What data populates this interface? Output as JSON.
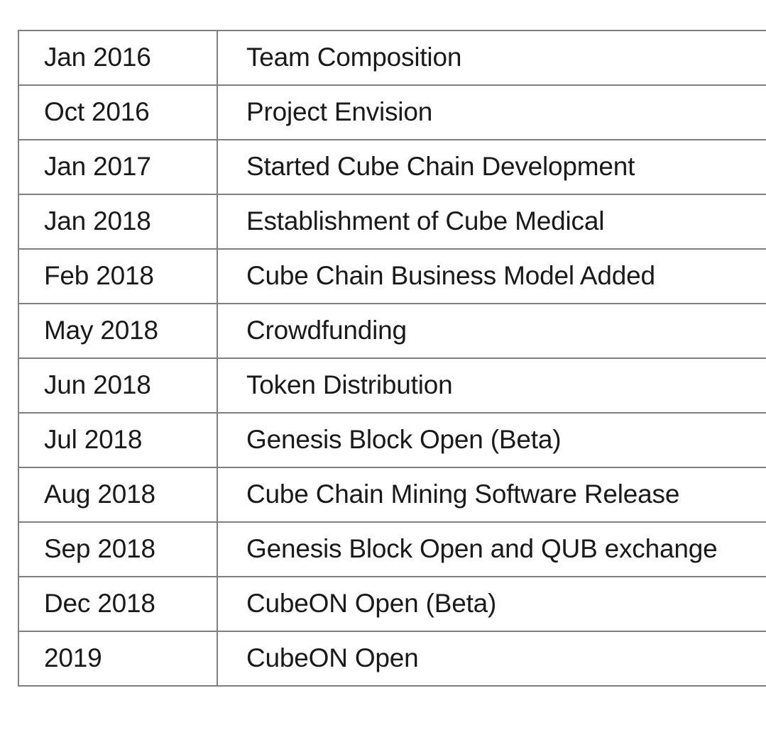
{
  "table": {
    "columns": [
      "date",
      "event"
    ],
    "border_color": "#7f7f7f",
    "text_color": "#1a1a1a",
    "background_color": "#ffffff",
    "rows": [
      {
        "date": "Jan 2016",
        "event": "Team Composition"
      },
      {
        "date": "Oct 2016",
        "event": "Project Envision"
      },
      {
        "date": "Jan 2017",
        "event": "Started Cube Chain Development"
      },
      {
        "date": "Jan 2018",
        "event": "Establishment of Cube Medical"
      },
      {
        "date": "Feb 2018",
        "event": "Cube Chain Business Model Added"
      },
      {
        "date": "May 2018",
        "event": "Crowdfunding"
      },
      {
        "date": "Jun 2018",
        "event": "Token Distribution"
      },
      {
        "date": "Jul 2018",
        "event": "Genesis Block Open (Beta)"
      },
      {
        "date": "Aug 2018",
        "event": "Cube Chain Mining Software Release"
      },
      {
        "date": "Sep 2018",
        "event": "Genesis Block Open and QUB exchange"
      },
      {
        "date": "Dec 2018",
        "event": "CubeON Open (Beta)"
      },
      {
        "date": "2019",
        "event": "CubeON Open"
      }
    ]
  }
}
